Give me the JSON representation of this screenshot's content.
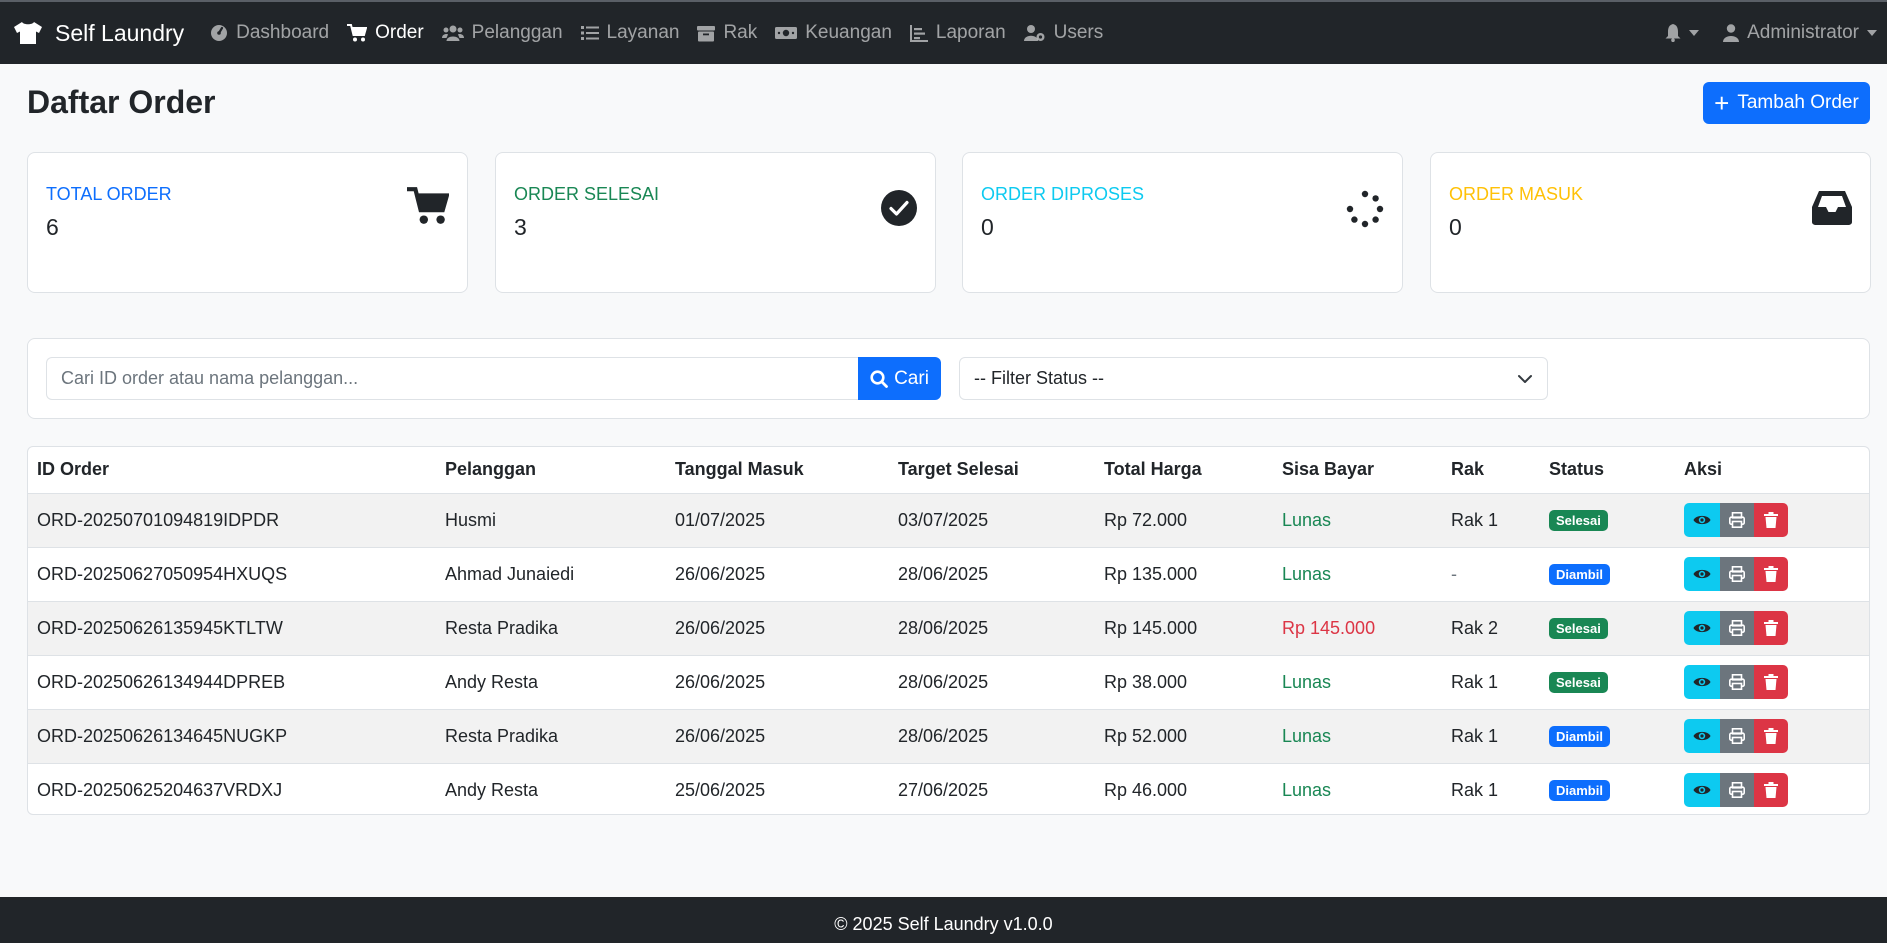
{
  "navbar": {
    "brand": "Self Laundry",
    "items": [
      {
        "label": "Dashboard",
        "icon": "gauge-icon"
      },
      {
        "label": "Order",
        "icon": "cart-icon",
        "active": true
      },
      {
        "label": "Pelanggan",
        "icon": "users-icon"
      },
      {
        "label": "Layanan",
        "icon": "list-icon"
      },
      {
        "label": "Rak",
        "icon": "archive-icon"
      },
      {
        "label": "Keuangan",
        "icon": "money-icon"
      },
      {
        "label": "Laporan",
        "icon": "chart-icon"
      },
      {
        "label": "Users",
        "icon": "users-cog-icon"
      }
    ],
    "user": "Administrator"
  },
  "page": {
    "title": "Daftar Order",
    "add_button": "Tambah Order"
  },
  "stats": [
    {
      "label": "TOTAL ORDER",
      "value": "6",
      "color": "#0d6efd",
      "icon": "cart-icon"
    },
    {
      "label": "ORDER SELESAI",
      "value": "3",
      "color": "#198754",
      "icon": "check-circle-icon"
    },
    {
      "label": "ORDER DIPROSES",
      "value": "0",
      "color": "#0dcaf0",
      "icon": "spinner-icon"
    },
    {
      "label": "ORDER MASUK",
      "value": "0",
      "color": "#ffc107",
      "icon": "inbox-icon"
    }
  ],
  "search": {
    "placeholder": "Cari ID order atau nama pelanggan...",
    "button": "Cari",
    "filter": "-- Filter Status --"
  },
  "table": {
    "headers": [
      "ID Order",
      "Pelanggan",
      "Tanggal Masuk",
      "Target Selesai",
      "Total Harga",
      "Sisa Bayar",
      "Rak",
      "Status",
      "Aksi"
    ],
    "rows": [
      {
        "id": "ORD-20250701094819IDPDR",
        "customer": "Husmi",
        "in": "01/07/2025",
        "target": "03/07/2025",
        "total": "Rp 72.000",
        "sisa": "Lunas",
        "rak": "Rak 1",
        "status": "Selesai"
      },
      {
        "id": "ORD-20250627050954HXUQS",
        "customer": "Ahmad Junaiedi",
        "in": "26/06/2025",
        "target": "28/06/2025",
        "total": "Rp 135.000",
        "sisa": "Lunas",
        "rak": "-",
        "status": "Diambil"
      },
      {
        "id": "ORD-20250626135945KTLTW",
        "customer": "Resta Pradika",
        "in": "26/06/2025",
        "target": "28/06/2025",
        "total": "Rp 145.000",
        "sisa": "Rp 145.000",
        "rak": "Rak 2",
        "status": "Selesai"
      },
      {
        "id": "ORD-20250626134944DPREB",
        "customer": "Andy Resta",
        "in": "26/06/2025",
        "target": "28/06/2025",
        "total": "Rp 38.000",
        "sisa": "Lunas",
        "rak": "Rak 1",
        "status": "Selesai"
      },
      {
        "id": "ORD-20250626134645NUGKP",
        "customer": "Resta Pradika",
        "in": "26/06/2025",
        "target": "28/06/2025",
        "total": "Rp 52.000",
        "sisa": "Lunas",
        "rak": "Rak 1",
        "status": "Diambil"
      },
      {
        "id": "ORD-20250625204637VRDXJ",
        "customer": "Andy Resta",
        "in": "25/06/2025",
        "target": "27/06/2025",
        "total": "Rp 46.000",
        "sisa": "Lunas",
        "rak": "Rak 1",
        "status": "Diambil"
      }
    ]
  },
  "footer": "© 2025 Self Laundry v1.0.0"
}
